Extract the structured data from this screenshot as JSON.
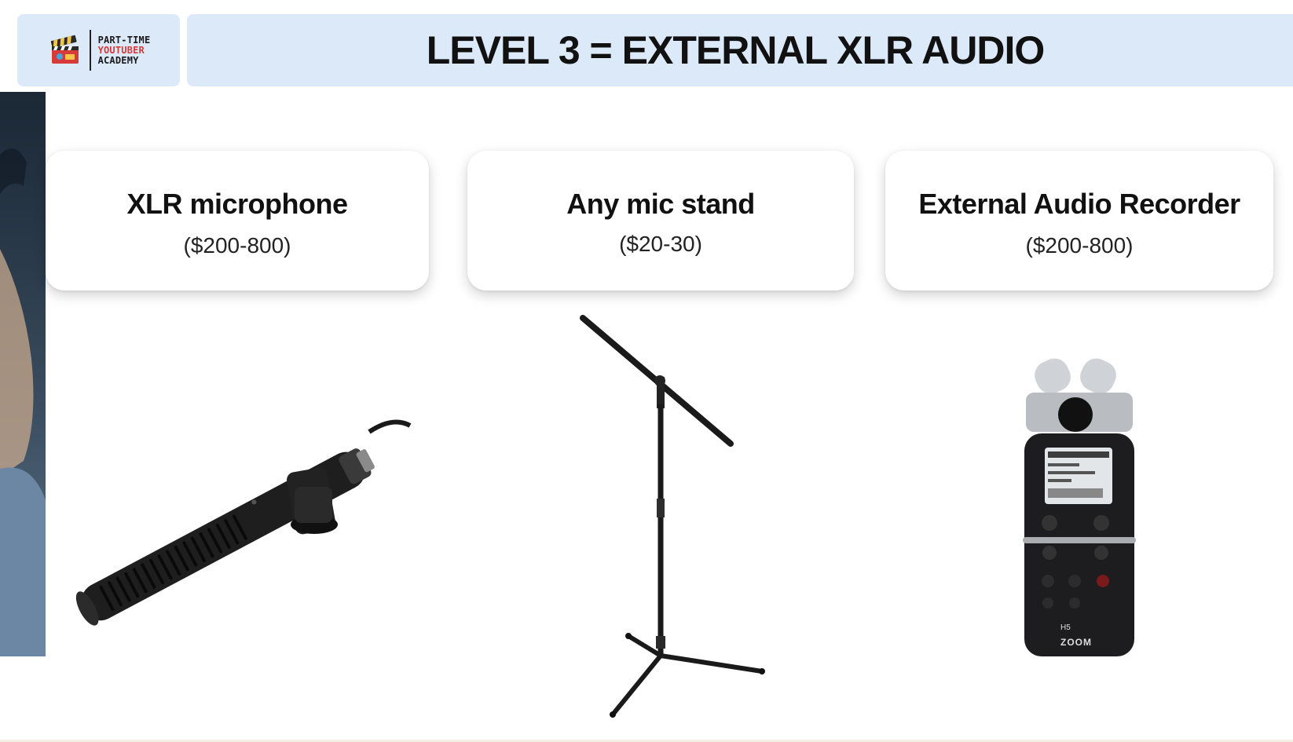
{
  "logo": {
    "line1": "PART-TIME",
    "line2": "YOUTUBER",
    "line3": "ACADEMY",
    "icon": "film-clapper-icon"
  },
  "title": "LEVEL 3 = EXTERNAL XLR AUDIO",
  "cards": [
    {
      "title": "XLR microphone",
      "price": "($200-800)",
      "image": "shotgun-microphone"
    },
    {
      "title": "Any mic stand",
      "price": "($20-30)",
      "image": "boom-mic-stand"
    },
    {
      "title": "External Audio Recorder",
      "price": "($200-800)",
      "image": "handheld-audio-recorder"
    }
  ],
  "recorder": {
    "model": "H5",
    "brand": "ZOOM"
  },
  "colors": {
    "header_bg": "#dce9f8",
    "logo_accent": "#d63a3a",
    "card_bg": "#ffffff"
  }
}
